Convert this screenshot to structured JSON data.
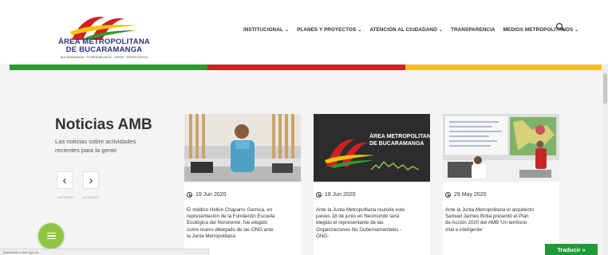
{
  "header": {
    "logo_title": "ÁREA METROPOLITANA DE BUCARAMANGA",
    "logo_subtitle": "BUCARAMANGA · FLORIDABLANCA · GIRÓN · PIEDECUESTA",
    "nav": [
      {
        "label": "INSTITUCIONAL",
        "has_dropdown": true
      },
      {
        "label": "PLANES Y PROYECTOS",
        "has_dropdown": true
      },
      {
        "label": "ATENCIÓN AL CIUDADANO",
        "has_dropdown": true
      },
      {
        "label": "TRANSPARENCIA",
        "has_dropdown": false
      },
      {
        "label": "MEDIOS METROPOLITANOS",
        "has_dropdown": true
      }
    ],
    "search_icon": "search-icon"
  },
  "colors": {
    "green": "#2f9a2c",
    "red": "#d21f26",
    "yellow": "#f2c400",
    "fab": "#8dc63f",
    "translate": "#1f9a3a"
  },
  "news": {
    "title": "Noticias AMB",
    "description": "Las noticias sobre actividades recientes para la gente",
    "prev_label": "ANTERIOR",
    "next_label": "SIGUIENTE",
    "cards": [
      {
        "date": "19 Jun 2020",
        "text": "El médico Helkin Chaparro Garnica, en representación de la Fundación Escuela Ecológica del Nororiente, fue elegido como nuevo delegado de las ONG ante la Junta Metropolitana"
      },
      {
        "date": "18 Jun 2020",
        "text": "Ante la Junta Metropolitana reunida este jueves 18 de junio en Neomundo será elegido el representante de las Organizaciones No Gubernamentales -ONG-",
        "image_text_1": "ÁREA METROPOLITANA",
        "image_text_2": "DE BUCARAMANGA"
      },
      {
        "date": "29 May 2020",
        "text": "Ante la Junta Metropolitana el arquitecto Samuel Jaimes Botia presentó el Plan de Acción 2020 del AMB 'Un territorio vital e inteligente'"
      }
    ]
  },
  "menu_button_icon": "menu-icon",
  "translate_label": "Traducir »",
  "status_text": "Esperando a amb.gov.co..."
}
